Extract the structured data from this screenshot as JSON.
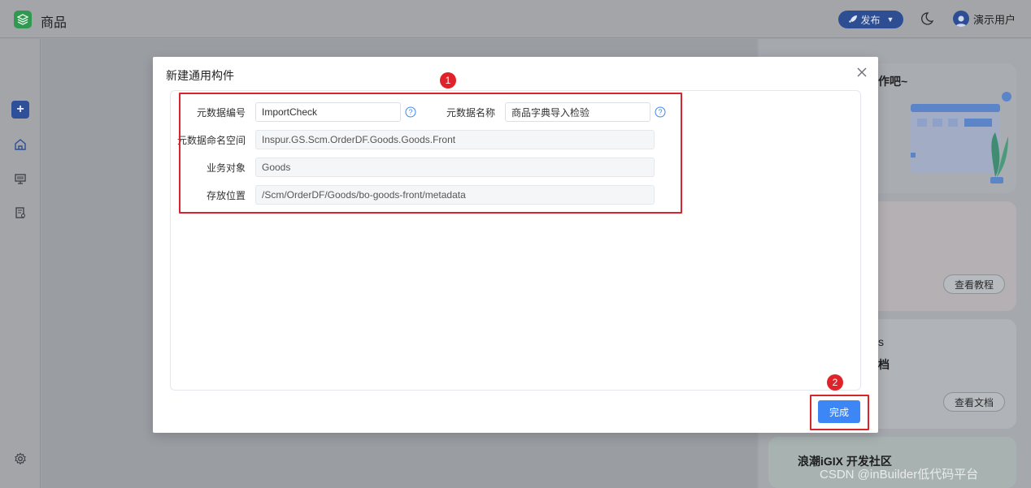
{
  "app": {
    "title": "商品"
  },
  "header": {
    "publish_label": "发布",
    "user_name": "演示用户"
  },
  "sidebar": {
    "icons": [
      "add-icon",
      "home-icon",
      "monitor-icon",
      "document-icon",
      "settings-icon"
    ]
  },
  "right_panel": {
    "greeting_fragment": "作吧~",
    "view_tutorial_label": "查看教程",
    "doc_fragment_1": "s",
    "doc_fragment_2": "档",
    "view_docs_label": "查看文档",
    "community_label": "浪潮iGIX 开发社区"
  },
  "modal": {
    "title": "新建通用构件",
    "fields": {
      "code": {
        "label": "元数据编号",
        "value": "ImportCheck"
      },
      "name": {
        "label": "元数据名称",
        "value": "商品字典导入检验"
      },
      "namespace": {
        "label": "元数据命名空间",
        "value": "Inspur.GS.Scm.OrderDF.Goods.Goods.Front"
      },
      "business_object": {
        "label": "业务对象",
        "value": "Goods"
      },
      "location": {
        "label": "存放位置",
        "value": "/Scm/OrderDF/Goods/bo-goods-front/metadata"
      }
    },
    "done_label": "完成"
  },
  "annotations": {
    "badge_1": "1",
    "badge_2": "2"
  },
  "watermark": "CSDN @inBuilder低代码平台",
  "colors": {
    "primary": "#3d86f5",
    "annotation_red": "#d8252b",
    "brand_green": "#2f9a4f"
  }
}
